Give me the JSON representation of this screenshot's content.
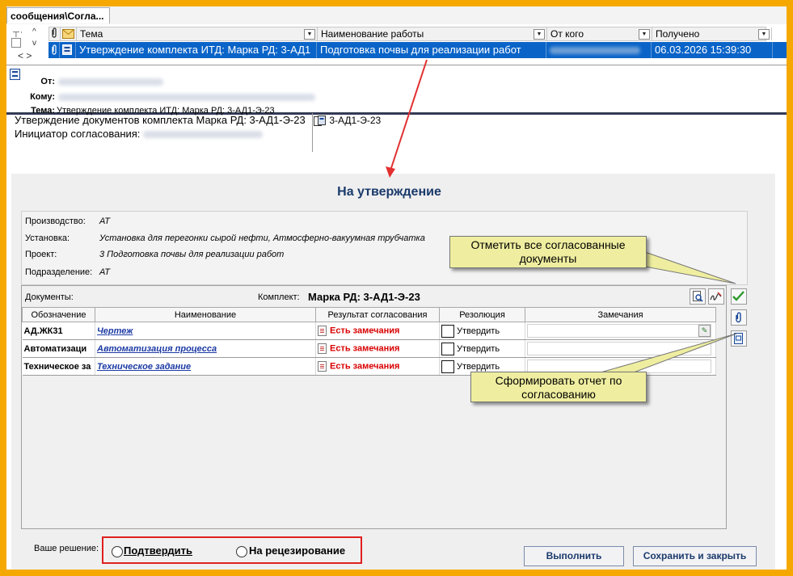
{
  "tab": {
    "label": "сообщения\\Согла..."
  },
  "msglist": {
    "columns": [
      "Тема",
      "Наименование работы",
      "От кого",
      "Получено"
    ],
    "row": {
      "subject": "Утверждение комплекта ИТД: Марка РД: 3-АД1",
      "work": "Подготовка почвы для реализации работ",
      "from": "",
      "received": "06.03.2026 15:39:30"
    }
  },
  "header": {
    "from_label": "От:",
    "to_label": "Кому:",
    "subject_label": "Тема:",
    "subject": "Утверждение комплекта ИТД: Марка РД: 3-АД1-Э-23"
  },
  "body": {
    "line1": "Утверждение документов комплекта Марка РД: 3-АД1-Э-23",
    "initiator_label": "Инициатор согласования:"
  },
  "attachment": {
    "name": "3-АД1-Э-23"
  },
  "form": {
    "title": "На утверждение",
    "info": [
      {
        "label": "Производство:",
        "value": "АТ"
      },
      {
        "label": "Установка:",
        "value": "Установка для перегонки сырой нефти, Атмосферно-вакуумная трубчатка"
      },
      {
        "label": "Проект:",
        "value": "3 Подготовка почвы для реализации работ"
      },
      {
        "label": "Подразделение:",
        "value": "АТ"
      }
    ],
    "docs_label": "Документы:",
    "kit_label": "Комплект:",
    "kit_value": "Марка РД: 3-АД1-Э-23",
    "grid_headers": [
      "Обозначение",
      "Наименование",
      "Результат согласования",
      "Резолюция",
      "Замечания"
    ],
    "rows": [
      {
        "code": "АД.ЖК31",
        "name": "Чертеж",
        "result": "Есть замечания",
        "resolution": "Утвердить"
      },
      {
        "code": "Автоматизаци",
        "name": "Автоматизация процесса",
        "result": "Есть замечания",
        "resolution": "Утвердить"
      },
      {
        "code": "Техническое за",
        "name": "Техническое задание",
        "result": "Есть замечания",
        "resolution": "Утвердить"
      }
    ],
    "decision_label": "Ваше решение:",
    "option_confirm": "Подтвердить",
    "option_review": "На рецезирование",
    "execute_button": "Выполнить",
    "save_close_button": "Сохранить и закрыть"
  },
  "callouts": {
    "mark_all": "Отметить все согласованные документы",
    "report": "Сформировать отчет по согласованию"
  },
  "icons": [
    "paperclip-icon",
    "envelope-icon",
    "document-icon",
    "search-doc-icon",
    "signature-icon",
    "checkmark-icon",
    "attach-icon",
    "report-icon",
    "pen-icon"
  ],
  "colors": {
    "selection": "#0a64c8",
    "alert": "#d90000",
    "link": "#1c3aa4",
    "frame": "#f5a800",
    "callout": "#efeea0",
    "highlight": "#e02020"
  }
}
